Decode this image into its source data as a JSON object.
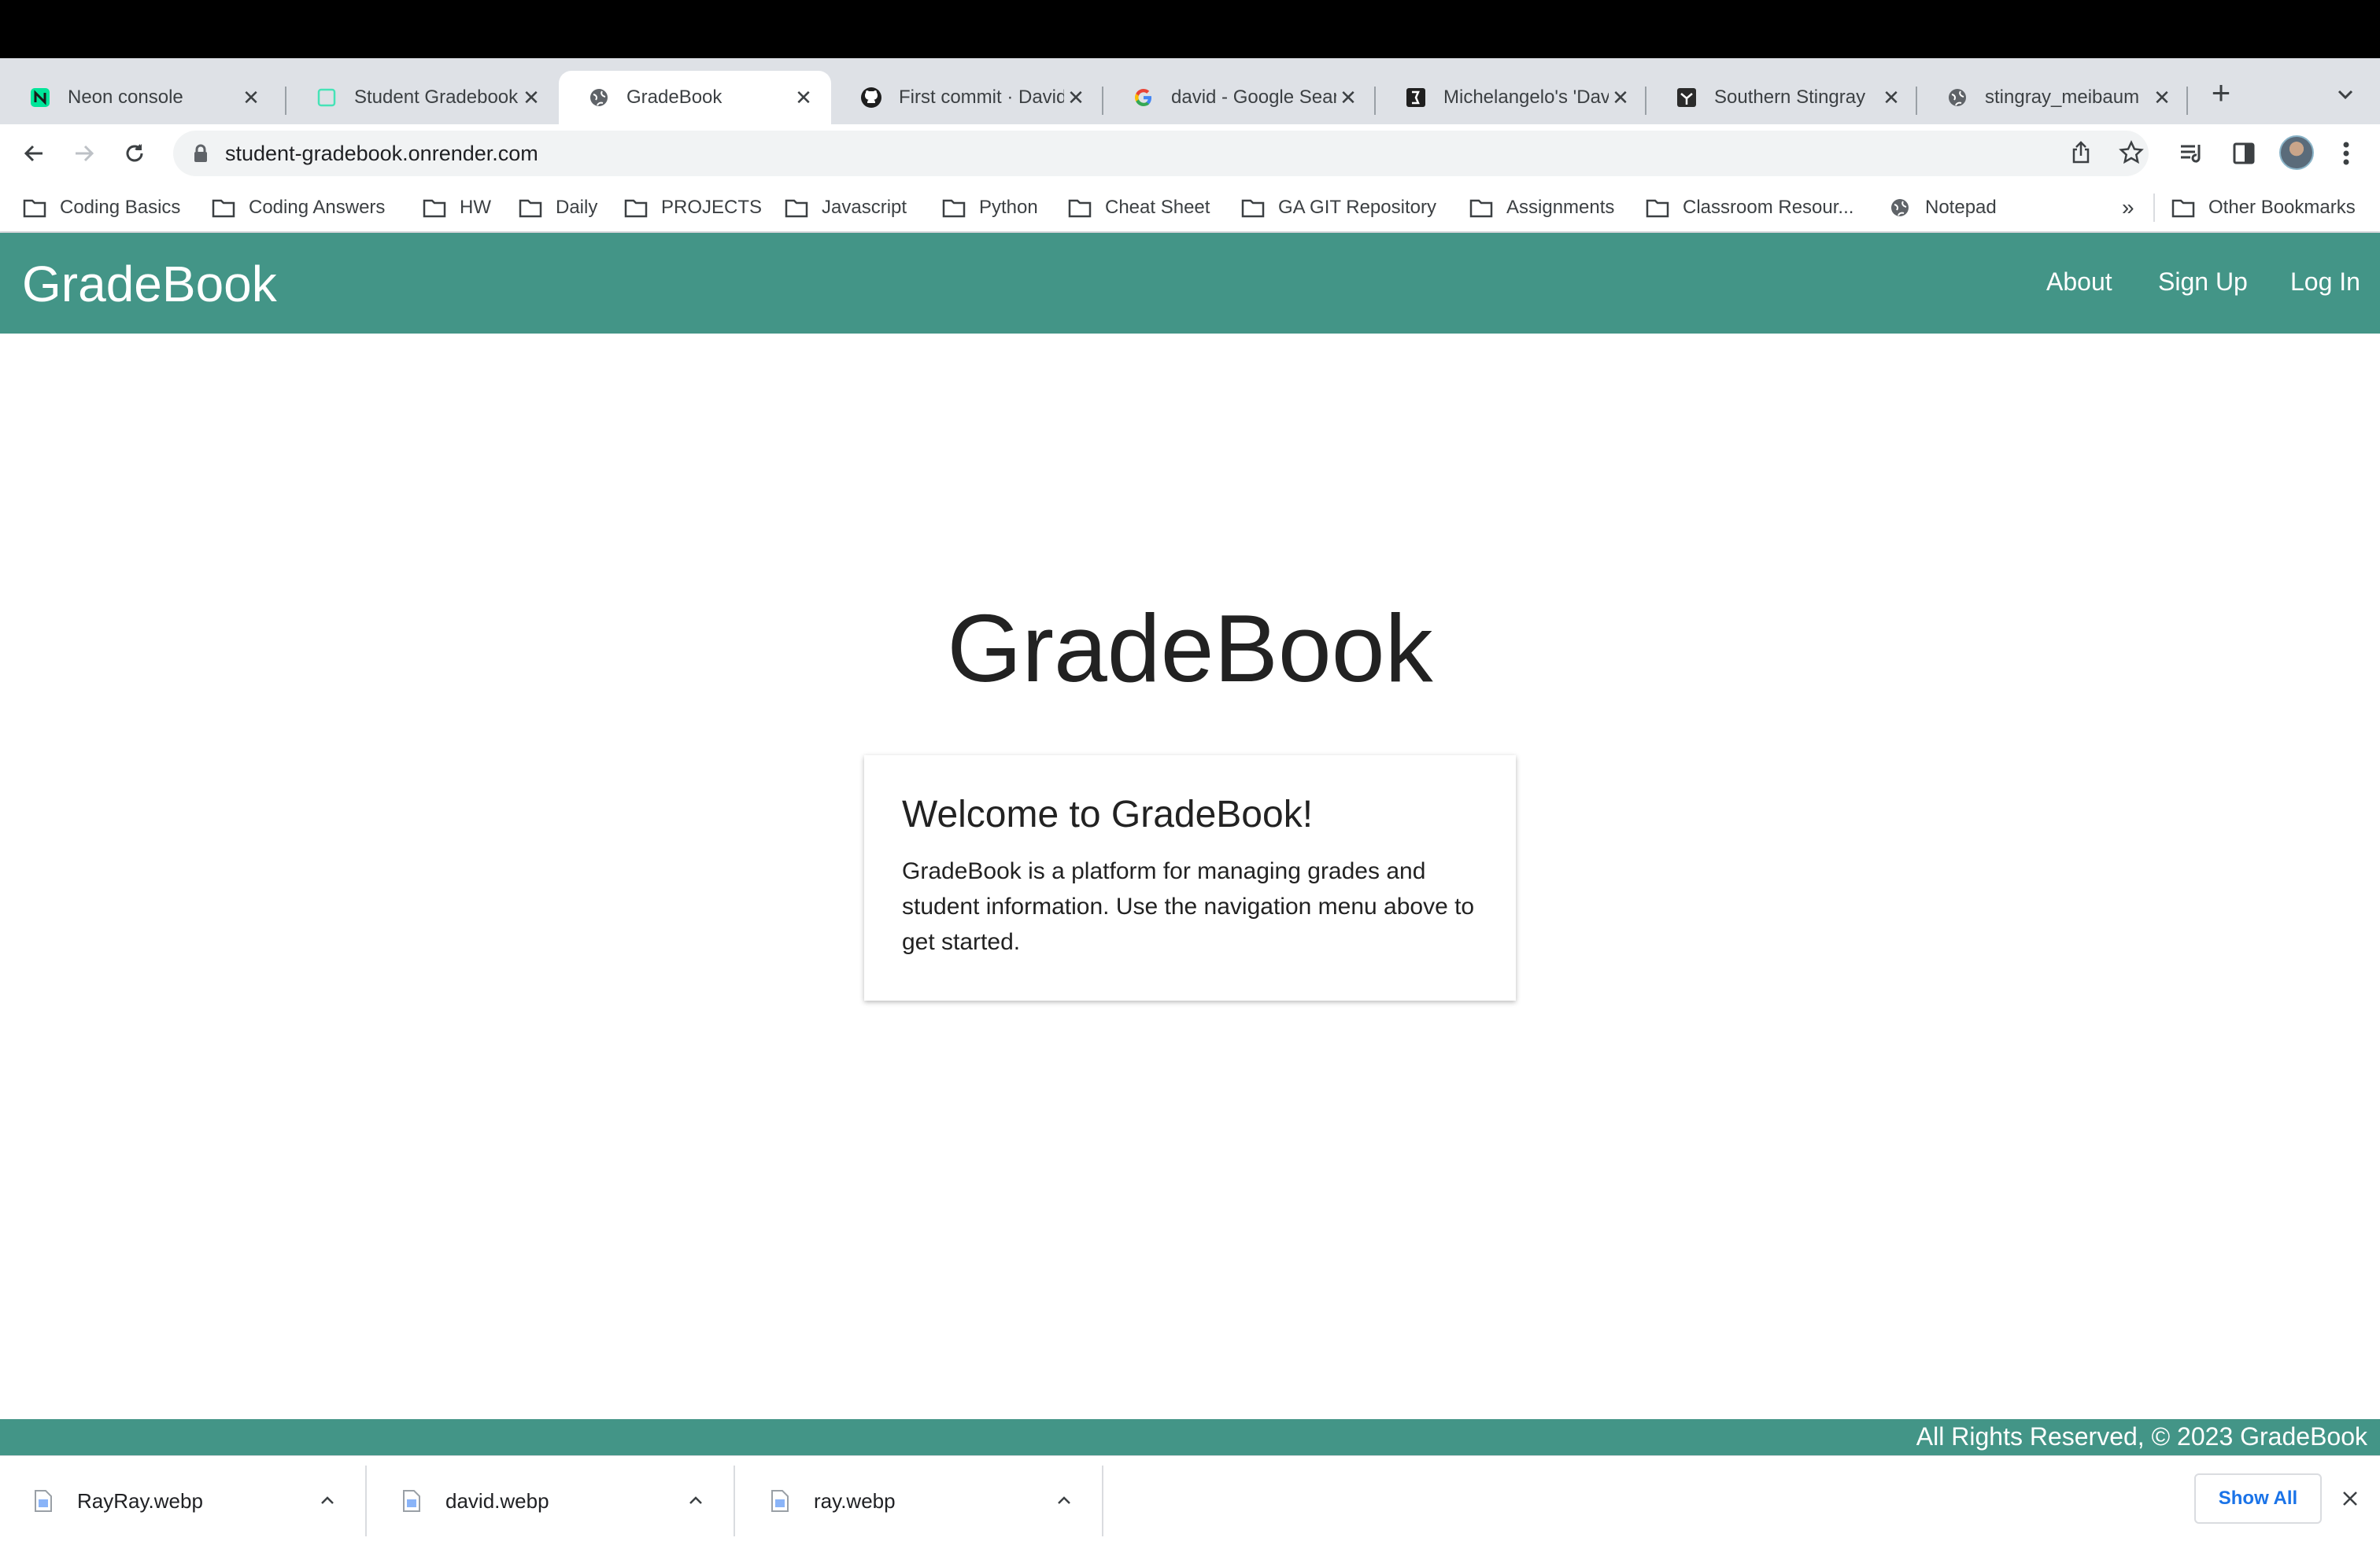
{
  "browser": {
    "tabs": [
      {
        "title": "Neon console",
        "icon": "neon-icon"
      },
      {
        "title": "Student Gradebook",
        "icon": "render-icon"
      },
      {
        "title": "GradeBook",
        "icon": "globe-icon",
        "active": true
      },
      {
        "title": "First commit · David",
        "icon": "github-icon"
      },
      {
        "title": "david - Google Search",
        "icon": "google-icon"
      },
      {
        "title": "Michelangelo's 'David'",
        "icon": "britannica-icon"
      },
      {
        "title": "Southern Stingray",
        "icon": "stingray-site-icon"
      },
      {
        "title": "stingray_meibaum",
        "icon": "globe-icon"
      }
    ],
    "new_tab_label": "+",
    "url": "student-gradebook.onrender.com",
    "bookmarks": [
      {
        "label": "Coding Basics",
        "icon": "folder-icon"
      },
      {
        "label": "Coding Answers",
        "icon": "folder-icon"
      },
      {
        "label": "HW",
        "icon": "folder-icon"
      },
      {
        "label": "Daily",
        "icon": "folder-icon"
      },
      {
        "label": "PROJECTS",
        "icon": "folder-icon"
      },
      {
        "label": "Javascript",
        "icon": "folder-icon"
      },
      {
        "label": "Python",
        "icon": "folder-icon"
      },
      {
        "label": "Cheat Sheet",
        "icon": "folder-icon"
      },
      {
        "label": "GA GIT Repository",
        "icon": "folder-icon"
      },
      {
        "label": "Assignments",
        "icon": "folder-icon"
      },
      {
        "label": "Classroom Resour...",
        "icon": "folder-icon"
      },
      {
        "label": "Notepad",
        "icon": "globe-icon"
      }
    ],
    "bookmarks_overflow": "»",
    "other_bookmarks": "Other Bookmarks"
  },
  "app": {
    "brand": "GradeBook",
    "nav": {
      "about": "About",
      "signup": "Sign Up",
      "login": "Log In"
    },
    "hero_title": "GradeBook",
    "card": {
      "title": "Welcome to GradeBook!",
      "text": "GradeBook is a platform for managing grades and student information. Use the navigation menu above to get started."
    },
    "footer": "All Rights Reserved, © 2023 GradeBook",
    "accent_color": "#439587"
  },
  "downloads": {
    "items": [
      "RayRay.webp",
      "david.webp",
      "ray.webp"
    ],
    "show_all": "Show All"
  }
}
